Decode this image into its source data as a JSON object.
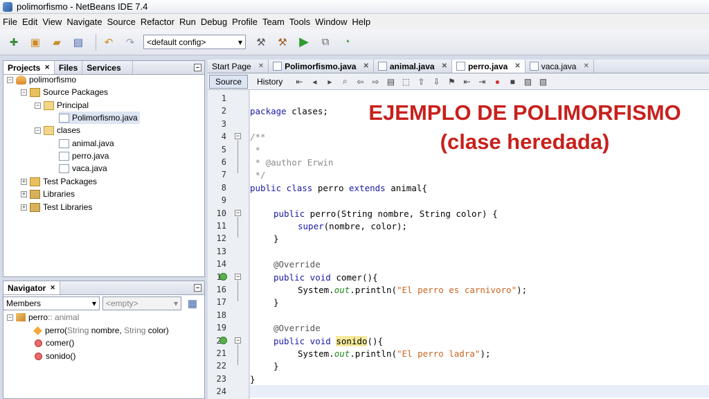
{
  "window": {
    "title": "polimorfismo - NetBeans IDE 7.4"
  },
  "menu": [
    "File",
    "Edit",
    "View",
    "Navigate",
    "Source",
    "Refactor",
    "Run",
    "Debug",
    "Profile",
    "Team",
    "Tools",
    "Window",
    "Help"
  ],
  "toolbar": {
    "config": "<default config>"
  },
  "projects_panel": {
    "tabs": [
      "Projects",
      "Files",
      "Services"
    ],
    "tree": {
      "project": "polimorfismo",
      "source_packages": "Source Packages",
      "pkg_principal": "Principal",
      "file_main": "Polimorfismo.java",
      "pkg_clases": "clases",
      "file_animal": "animal.java",
      "file_perro": "perro.java",
      "file_vaca": "vaca.java",
      "test_packages": "Test Packages",
      "libraries": "Libraries",
      "test_libraries": "Test Libraries"
    }
  },
  "navigator": {
    "title": "Navigator",
    "filter": "Members",
    "empty": "<empty>",
    "class_name": "perro",
    "class_super": " :: animal",
    "ctor_name": "perro",
    "ctor_params_open": "(",
    "ctor_param1_type": "String",
    "ctor_param1_name": " nombre, ",
    "ctor_param2_type": "String",
    "ctor_param2_name": " color",
    "ctor_params_close": ")",
    "method1": "comer()",
    "method2": "sonido()"
  },
  "editor": {
    "tabs": [
      "Start Page",
      "Polimorfismo.java",
      "animal.java",
      "perro.java",
      "vaca.java"
    ],
    "source_btn": "Source",
    "history_btn": "History",
    "headline1": "EJEMPLO DE POLIMORFISMO",
    "headline2": "(clase heredada)",
    "line_numbers": [
      "1",
      "2",
      "3",
      "4",
      "5",
      "6",
      "7",
      "8",
      "9",
      "10",
      "11",
      "12",
      "13",
      "14",
      "15",
      "16",
      "17",
      "18",
      "19",
      "20",
      "21",
      "22",
      "23",
      "24"
    ],
    "code": {
      "l2a": "package",
      "l2b": " clases;",
      "l4": "/**",
      "l5": " *",
      "l6": " * @author Erwin",
      "l7": " */",
      "l8a": "public class",
      "l8b": " perro ",
      "l8c": "extends",
      "l8d": " animal{",
      "l10a": "public",
      "l10b": " perro(String nombre, String color) {",
      "l11a": "super",
      "l11b": "(nombre, color);",
      "l12": "}",
      "l14": "@Override",
      "l15a": "public void",
      "l15b": " comer(){",
      "l16a": "System.",
      "l16b": "out",
      "l16c": ".println(",
      "l16d": "\"El perro es carnivoro\"",
      "l16e": ");",
      "l17": "}",
      "l19": "@Override",
      "l20a": "public void",
      "l20b": " ",
      "l20c": "sonido",
      "l20d": "(){",
      "l21a": "System.",
      "l21b": "out",
      "l21c": ".println(",
      "l21d": "\"El perro ladra\"",
      "l21e": ");",
      "l22": "}",
      "l23": "}"
    }
  }
}
